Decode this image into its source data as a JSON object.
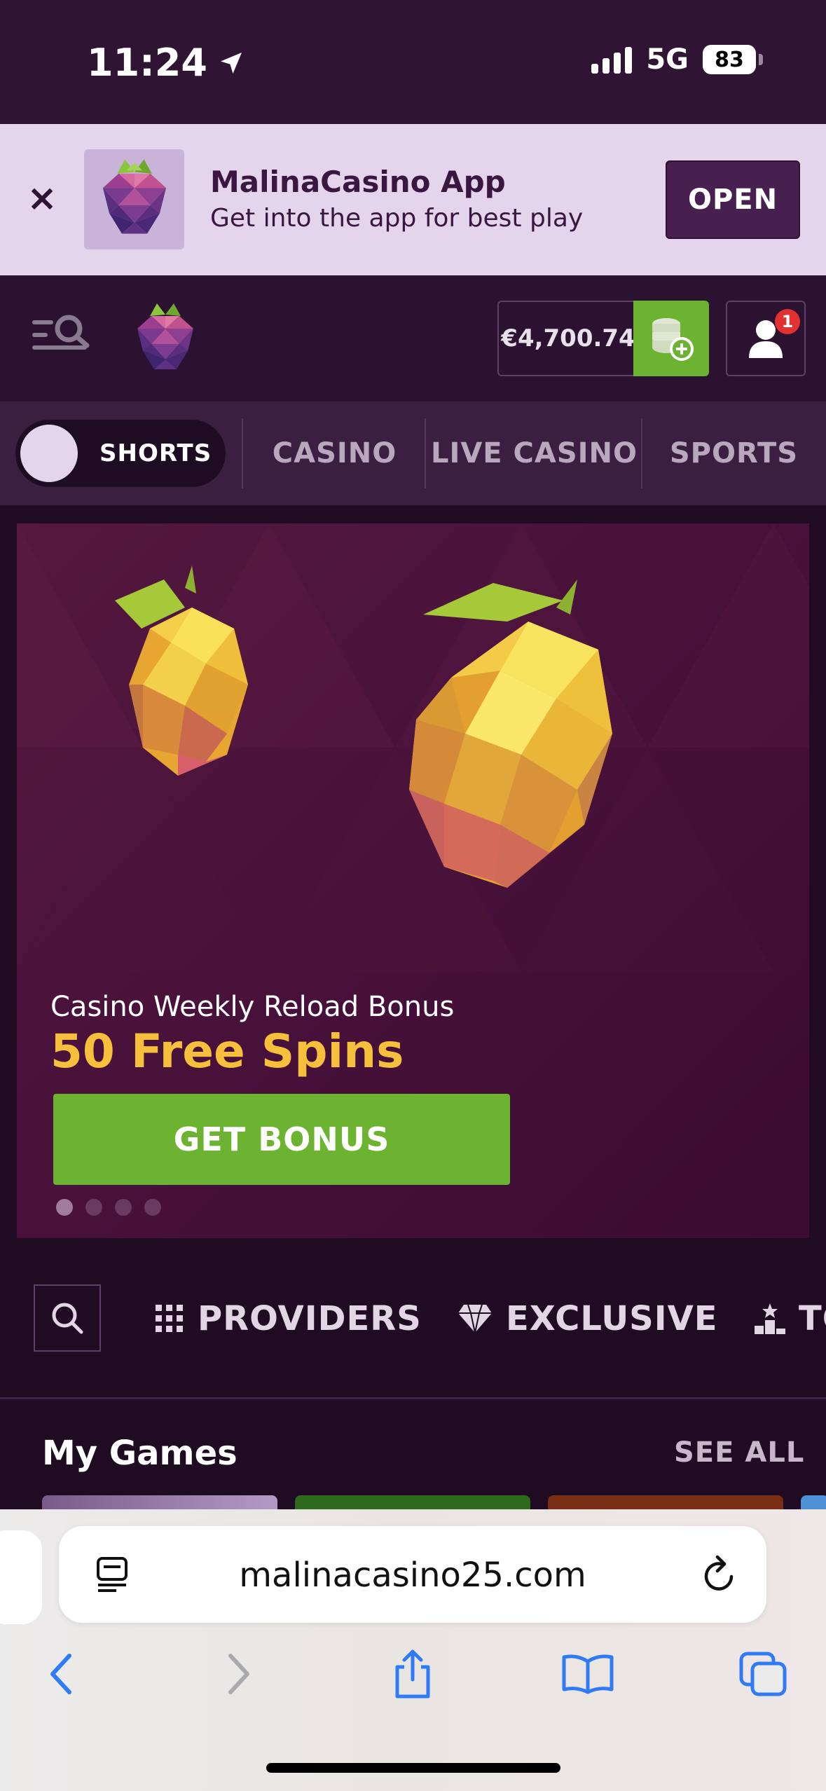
{
  "status_bar": {
    "time": "11:24",
    "network": "5G",
    "battery": "83"
  },
  "app_banner": {
    "close": "×",
    "title": "MalinaCasino App",
    "subtitle": "Get into the app for best play",
    "open_label": "OPEN"
  },
  "header": {
    "balance": "€4,700.74",
    "notification_count": "1"
  },
  "nav": {
    "shorts_label": "SHORTS",
    "tabs": [
      "CASINO",
      "LIVE CASINO",
      "SPORTS"
    ]
  },
  "hero": {
    "subtitle": "Casino Weekly Reload Bonus",
    "title": "50 Free Spins",
    "button_label": "GET BONUS",
    "slide_count": 4,
    "active_slide": 1
  },
  "categories": {
    "providers_label": "PROVIDERS",
    "exclusive_label": "EXCLUSIVE",
    "top_label_partial": "TO"
  },
  "my_games": {
    "title": "My Games",
    "see_all": "SEE ALL"
  },
  "browser": {
    "url": "malinacasino25.com"
  },
  "colors": {
    "accent_green": "#6bb331",
    "bonus_gold": "#f7c03c",
    "brand_purple": "#2b1230",
    "ios_blue": "#2f7bf5"
  }
}
